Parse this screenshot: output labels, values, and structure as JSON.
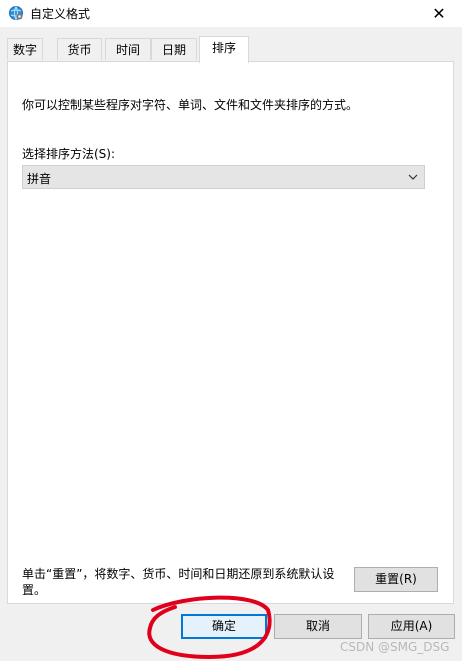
{
  "window": {
    "title": "自定义格式"
  },
  "tabs": [
    {
      "label": "数字"
    },
    {
      "label": "货币"
    },
    {
      "label": "时间"
    },
    {
      "label": "日期"
    },
    {
      "label": "排序"
    }
  ],
  "panel": {
    "description": "你可以控制某些程序对字符、单词、文件和文件夹排序的方式。",
    "sort_label": "选择排序方法(S):",
    "sort_value": "拼音",
    "reset_note": "单击“重置”，将数字、货币、时间和日期还原到系统默认设置。",
    "reset_label": "重置(R)"
  },
  "buttons": {
    "ok": "确定",
    "cancel": "取消",
    "apply": "应用(A)"
  },
  "watermark": "CSDN @SMG_DSG",
  "colors": {
    "annotation": "#e0001b",
    "focus": "#0078d7"
  }
}
